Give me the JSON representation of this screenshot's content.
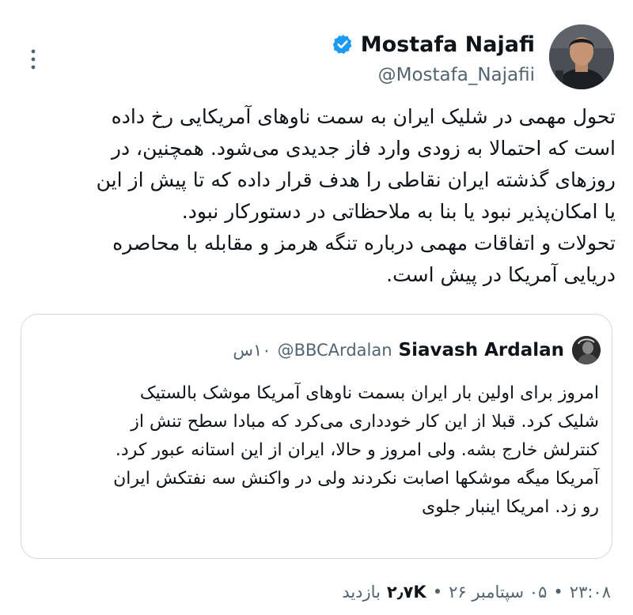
{
  "author": {
    "name": "Mostafa Najafi",
    "handle": "@Mostafa_Najafii",
    "verified": true
  },
  "tweet": {
    "lines": [
      "تحول مهمی در شلیک ایران به سمت ناوهای آمریکایی رخ داده",
      "است که احتمالا به زودی وارد فاز جدیدی می‌شود. همچنین، در",
      "روزهای گذشته ایران نقاطی را هدف قرار داده که تا پیش از این",
      "یا امکان‌پذیر نبود یا بنا به ملاحظاتی در دستورکار نبود.",
      "تحولات و اتفاقات مهمی درباره تنگه هرمز و مقابله با محاصره",
      "دریایی آمریکا در پیش است."
    ]
  },
  "quote": {
    "name": "Siavash Ardalan",
    "handle": "@BBCArdalan",
    "time": "۱۰س",
    "lines": [
      "امروز برای اولین بار ایران بسمت ناوهای آمریکا موشک بالستیک",
      "شلیک کرد.  قبلا از این کار خودداری می‌کرد که مبادا سطح تنش از",
      "کنترلش خارج بشه.  ولی امروز و حالا، ایران از این استانه عبور کرد.",
      "آمریکا میگه موشکها اصابت نکردند ولی در واکنش سه نفتکش ایران",
      "رو زد. امریکا اینبار جلوی"
    ]
  },
  "meta": {
    "time": "۲۳:۰۸",
    "sep1": "•",
    "date": "۰۵ سپتامبر ۲۶",
    "sep2": "•",
    "views": "۲٫۷K",
    "views_label": "بازدید"
  },
  "colors": {
    "text": "#0f1419",
    "secondary": "#536471",
    "verified_blue": "#1d9bf0",
    "border": "#cfd9de"
  },
  "icons": [
    "more-icon",
    "verified-icon",
    "avatar",
    "quote-avatar"
  ]
}
